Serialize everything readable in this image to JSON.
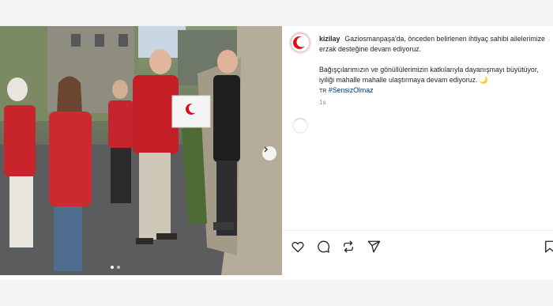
{
  "post": {
    "username": "kizilay",
    "caption_line1": "Gaziosmanpaşa'da, önceden belirlenen ihtiyaç sahibi ailelerimize erzak desteğine devam ediyoruz.",
    "caption_line2": "Bağışçılarımızın ve gönüllülerimizin katkılarıyla dayanışmayı büyütüyor, iyiliği mahalle mahalle ulaştırmaya devam ediyoruz. 🌙",
    "hashtag": "#SensizOlmaz",
    "hashtag_prefix": "TR",
    "timestamp": "1s"
  },
  "media": {
    "carousel_dots": 2,
    "active_dot": 0
  },
  "icons": {
    "like": "heart-icon",
    "comment": "comment-icon",
    "repost": "repost-icon",
    "share": "share-icon",
    "save": "bookmark-icon",
    "next": "chevron-right-icon"
  },
  "colors": {
    "brand_red": "#e30a17",
    "hashtag": "#00376b",
    "muted": "#8e8e8e"
  }
}
